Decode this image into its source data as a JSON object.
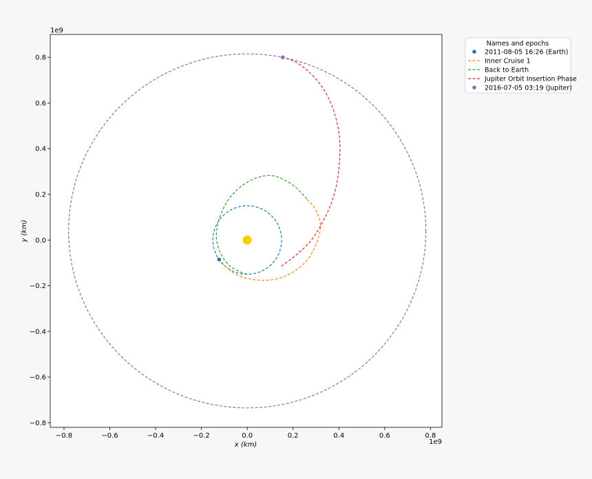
{
  "chart_data": {
    "type": "scatter",
    "xlabel": "x (km)",
    "ylabel": "y (km)",
    "x_exponent_label": "1e9",
    "y_exponent_label": "1e9",
    "xlim": [
      -0.86,
      0.85
    ],
    "ylim": [
      -0.82,
      0.9
    ],
    "x_ticks": [
      -0.8,
      -0.6,
      -0.4,
      -0.2,
      0.0,
      0.2,
      0.4,
      0.6,
      0.8
    ],
    "x_tick_labels": [
      "−0.8",
      "−0.6",
      "−0.4",
      "−0.2",
      "0.0",
      "0.2",
      "0.4",
      "0.6",
      "0.8"
    ],
    "y_ticks": [
      -0.8,
      -0.6,
      -0.4,
      -0.2,
      0.0,
      0.2,
      0.4,
      0.6,
      0.8
    ],
    "y_tick_labels": [
      "−0.8",
      "−0.6",
      "−0.4",
      "−0.2",
      "0.0",
      "0.2",
      "0.4",
      "0.6",
      "0.8"
    ],
    "grid": false,
    "legend": {
      "title": "Names and epochs",
      "placement": "outside-top-right",
      "entries": [
        {
          "label": "2011-08-05 16:26 (Earth)",
          "color": "#1f77b4",
          "marker": "dot"
        },
        {
          "label": "Inner Cruise 1",
          "color": "#ff7f0e",
          "marker": "dashed-line"
        },
        {
          "label": "Back to Earth",
          "color": "#2ca02c",
          "marker": "dashed-line"
        },
        {
          "label": "Jupiter Orbit Insertion Phase",
          "color": "#d62728",
          "marker": "dashed-line"
        },
        {
          "label": "2016-07-05 03:19 (Jupiter)",
          "color": "#9467bd",
          "marker": "dot"
        }
      ]
    },
    "sun": {
      "x": 0.0,
      "y": 0.0,
      "color": "#ffcc00"
    },
    "orbits": [
      {
        "body": "Earth",
        "color": "#1f77b4",
        "center": [
          0.0,
          0.0
        ],
        "rx": 0.15,
        "ry": 0.15
      },
      {
        "body": "Jupiter",
        "color": "#9467bd",
        "center": [
          0.0,
          0.04
        ],
        "rx": 0.78,
        "ry": 0.775
      }
    ],
    "series": [
      {
        "name": "Inner Cruise 1",
        "color": "#ff7f0e",
        "points": [
          [
            -0.123,
            -0.085
          ],
          [
            -0.09,
            -0.12
          ],
          [
            -0.05,
            -0.15
          ],
          [
            0.0,
            -0.168
          ],
          [
            0.06,
            -0.176
          ],
          [
            0.13,
            -0.17
          ],
          [
            0.2,
            -0.14
          ],
          [
            0.26,
            -0.09
          ],
          [
            0.3,
            -0.02
          ],
          [
            0.32,
            0.06
          ],
          [
            0.3,
            0.13
          ],
          [
            0.26,
            0.18
          ]
        ]
      },
      {
        "name": "Back to Earth",
        "color": "#2ca02c",
        "points": [
          [
            0.26,
            0.18
          ],
          [
            0.2,
            0.24
          ],
          [
            0.12,
            0.28
          ],
          [
            0.05,
            0.275
          ],
          [
            -0.02,
            0.24
          ],
          [
            -0.08,
            0.18
          ],
          [
            -0.12,
            0.1
          ],
          [
            -0.135,
            0.02
          ],
          [
            -0.12,
            -0.05
          ],
          [
            -0.08,
            -0.11
          ],
          [
            -0.03,
            -0.14
          ],
          [
            0.0,
            -0.15
          ]
        ]
      },
      {
        "name": "Jupiter Orbit Insertion Phase",
        "color": "#d62728",
        "points": [
          [
            0.15,
            -0.115
          ],
          [
            0.22,
            -0.06
          ],
          [
            0.28,
            0.0
          ],
          [
            0.33,
            0.08
          ],
          [
            0.37,
            0.17
          ],
          [
            0.395,
            0.27
          ],
          [
            0.405,
            0.4
          ],
          [
            0.395,
            0.5
          ],
          [
            0.365,
            0.6
          ],
          [
            0.32,
            0.68
          ],
          [
            0.265,
            0.74
          ],
          [
            0.21,
            0.78
          ],
          [
            0.155,
            0.8
          ]
        ]
      }
    ],
    "markers": [
      {
        "label": "2011-08-05 16:26 (Earth)",
        "x": -0.123,
        "y": -0.085,
        "color": "#1f77b4"
      },
      {
        "label": "2016-07-05 03:19 (Jupiter)",
        "x": 0.155,
        "y": 0.8,
        "color": "#9467bd"
      }
    ]
  }
}
